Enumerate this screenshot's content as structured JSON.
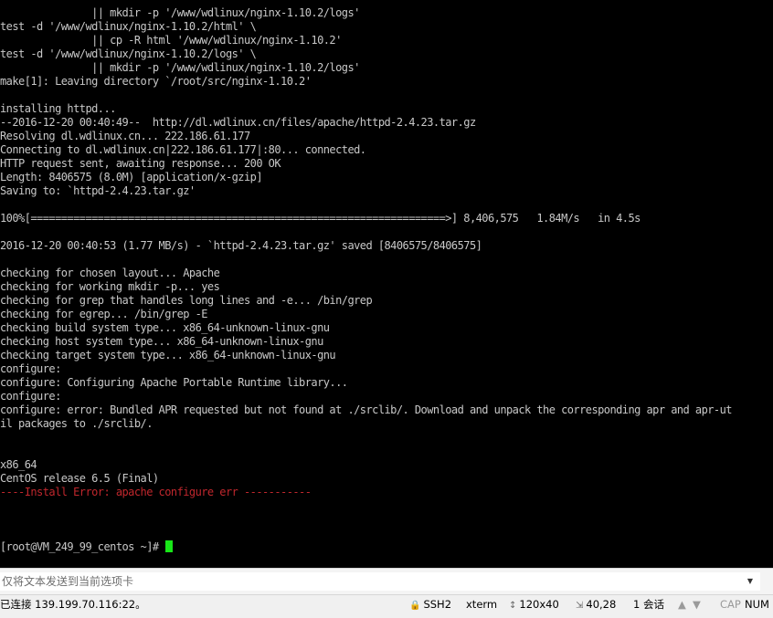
{
  "terminal": {
    "lines": [
      {
        "text": "               || mkdir -p '/www/wdlinux/nginx-1.10.2/logs'"
      },
      {
        "text": "test -d '/www/wdlinux/nginx-1.10.2/html' \\"
      },
      {
        "text": "               || cp -R html '/www/wdlinux/nginx-1.10.2'"
      },
      {
        "text": "test -d '/www/wdlinux/nginx-1.10.2/logs' \\"
      },
      {
        "text": "               || mkdir -p '/www/wdlinux/nginx-1.10.2/logs'"
      },
      {
        "text": "make[1]: Leaving directory `/root/src/nginx-1.10.2'"
      },
      {
        "text": ""
      },
      {
        "text": "installing httpd..."
      },
      {
        "text": "--2016-12-20 00:40:49--  http://dl.wdlinux.cn/files/apache/httpd-2.4.23.tar.gz"
      },
      {
        "text": "Resolving dl.wdlinux.cn... 222.186.61.177"
      },
      {
        "text": "Connecting to dl.wdlinux.cn|222.186.61.177|:80... connected."
      },
      {
        "text": "HTTP request sent, awaiting response... 200 OK"
      },
      {
        "text": "Length: 8406575 (8.0M) [application/x-gzip]"
      },
      {
        "text": "Saving to: `httpd-2.4.23.tar.gz'"
      },
      {
        "text": ""
      },
      {
        "text": "100%[====================================================================>] 8,406,575   1.84M/s   in 4.5s"
      },
      {
        "text": ""
      },
      {
        "text": "2016-12-20 00:40:53 (1.77 MB/s) - `httpd-2.4.23.tar.gz' saved [8406575/8406575]"
      },
      {
        "text": ""
      },
      {
        "text": "checking for chosen layout... Apache"
      },
      {
        "text": "checking for working mkdir -p... yes"
      },
      {
        "text": "checking for grep that handles long lines and -e... /bin/grep"
      },
      {
        "text": "checking for egrep... /bin/grep -E"
      },
      {
        "text": "checking build system type... x86_64-unknown-linux-gnu"
      },
      {
        "text": "checking host system type... x86_64-unknown-linux-gnu"
      },
      {
        "text": "checking target system type... x86_64-unknown-linux-gnu"
      },
      {
        "text": "configure:"
      },
      {
        "text": "configure: Configuring Apache Portable Runtime library..."
      },
      {
        "text": "configure:"
      },
      {
        "text": "configure: error: Bundled APR requested but not found at ./srclib/. Download and unpack the corresponding apr and apr-ut"
      },
      {
        "text": "il packages to ./srclib/."
      },
      {
        "text": ""
      },
      {
        "text": ""
      },
      {
        "text": "x86_64"
      },
      {
        "text": "CentOS release 6.5 (Final)"
      },
      {
        "text": "----Install Error: apache configure err -----------",
        "error": true
      },
      {
        "text": ""
      },
      {
        "text": ""
      },
      {
        "text": ""
      }
    ],
    "prompt": "[root@VM_249_99_centos ~]# ",
    "text_color": "#c8c8c8",
    "error_color": "#c1272d",
    "cursor_color": "#18e618"
  },
  "input_bar": {
    "placeholder": "仅将文本发送到当前选项卡",
    "dropdown_icon": "▼"
  },
  "status_bar": {
    "connection": "已连接 139.199.70.116:22。",
    "protocol": "SSH2",
    "terminal_type": "xterm",
    "size": "120x40",
    "cursor_position": "40,28",
    "sessions": "1 会话",
    "caps": "CAP",
    "num": "NUM"
  }
}
